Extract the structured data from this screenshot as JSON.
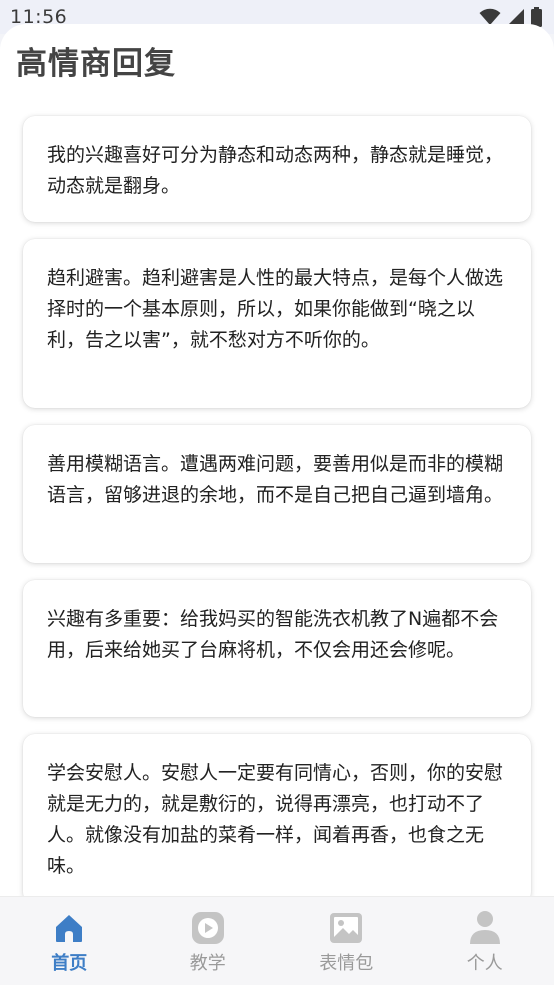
{
  "status_bar": {
    "time": "11:56",
    "icons": [
      "wifi-icon",
      "cellular-signal-icon",
      "battery-icon"
    ]
  },
  "page": {
    "title": "高情商回复"
  },
  "cards": [
    {
      "text": "我的兴趣喜好可分为静态和动态两种，静态就是睡觉，动态就是翻身。"
    },
    {
      "text": "趋利避害。趋利避害是人性的最大特点，是每个人做选择时的一个基本原则，所以，如果你能做到“晓之以利，告之以害”，就不愁对方不听你的。"
    },
    {
      "text": "善用模糊语言。遭遇两难问题，要善用似是而非的模糊语言，留够进退的余地，而不是自己把自己逼到墙角。"
    },
    {
      "text": "兴趣有多重要：给我妈买的智能洗衣机教了N遍都不会用，后来给她买了台麻将机，不仅会用还会修呢。"
    },
    {
      "text": "学会安慰人。安慰人一定要有同情心，否则，你的安慰就是无力的，就是敷衍的，说得再漂亮，也打动不了人。就像没有加盐的菜肴一样，闻着再香，也食之无味。"
    }
  ],
  "bottom_nav": {
    "active_color": "#3e7ec6",
    "inactive_color": "#c4c4c4",
    "items": [
      {
        "label": "首页",
        "icon": "home-icon",
        "active": true
      },
      {
        "label": "教学",
        "icon": "play-icon",
        "active": false
      },
      {
        "label": "表情包",
        "icon": "image-icon",
        "active": false
      },
      {
        "label": "个人",
        "icon": "person-icon",
        "active": false
      }
    ]
  }
}
